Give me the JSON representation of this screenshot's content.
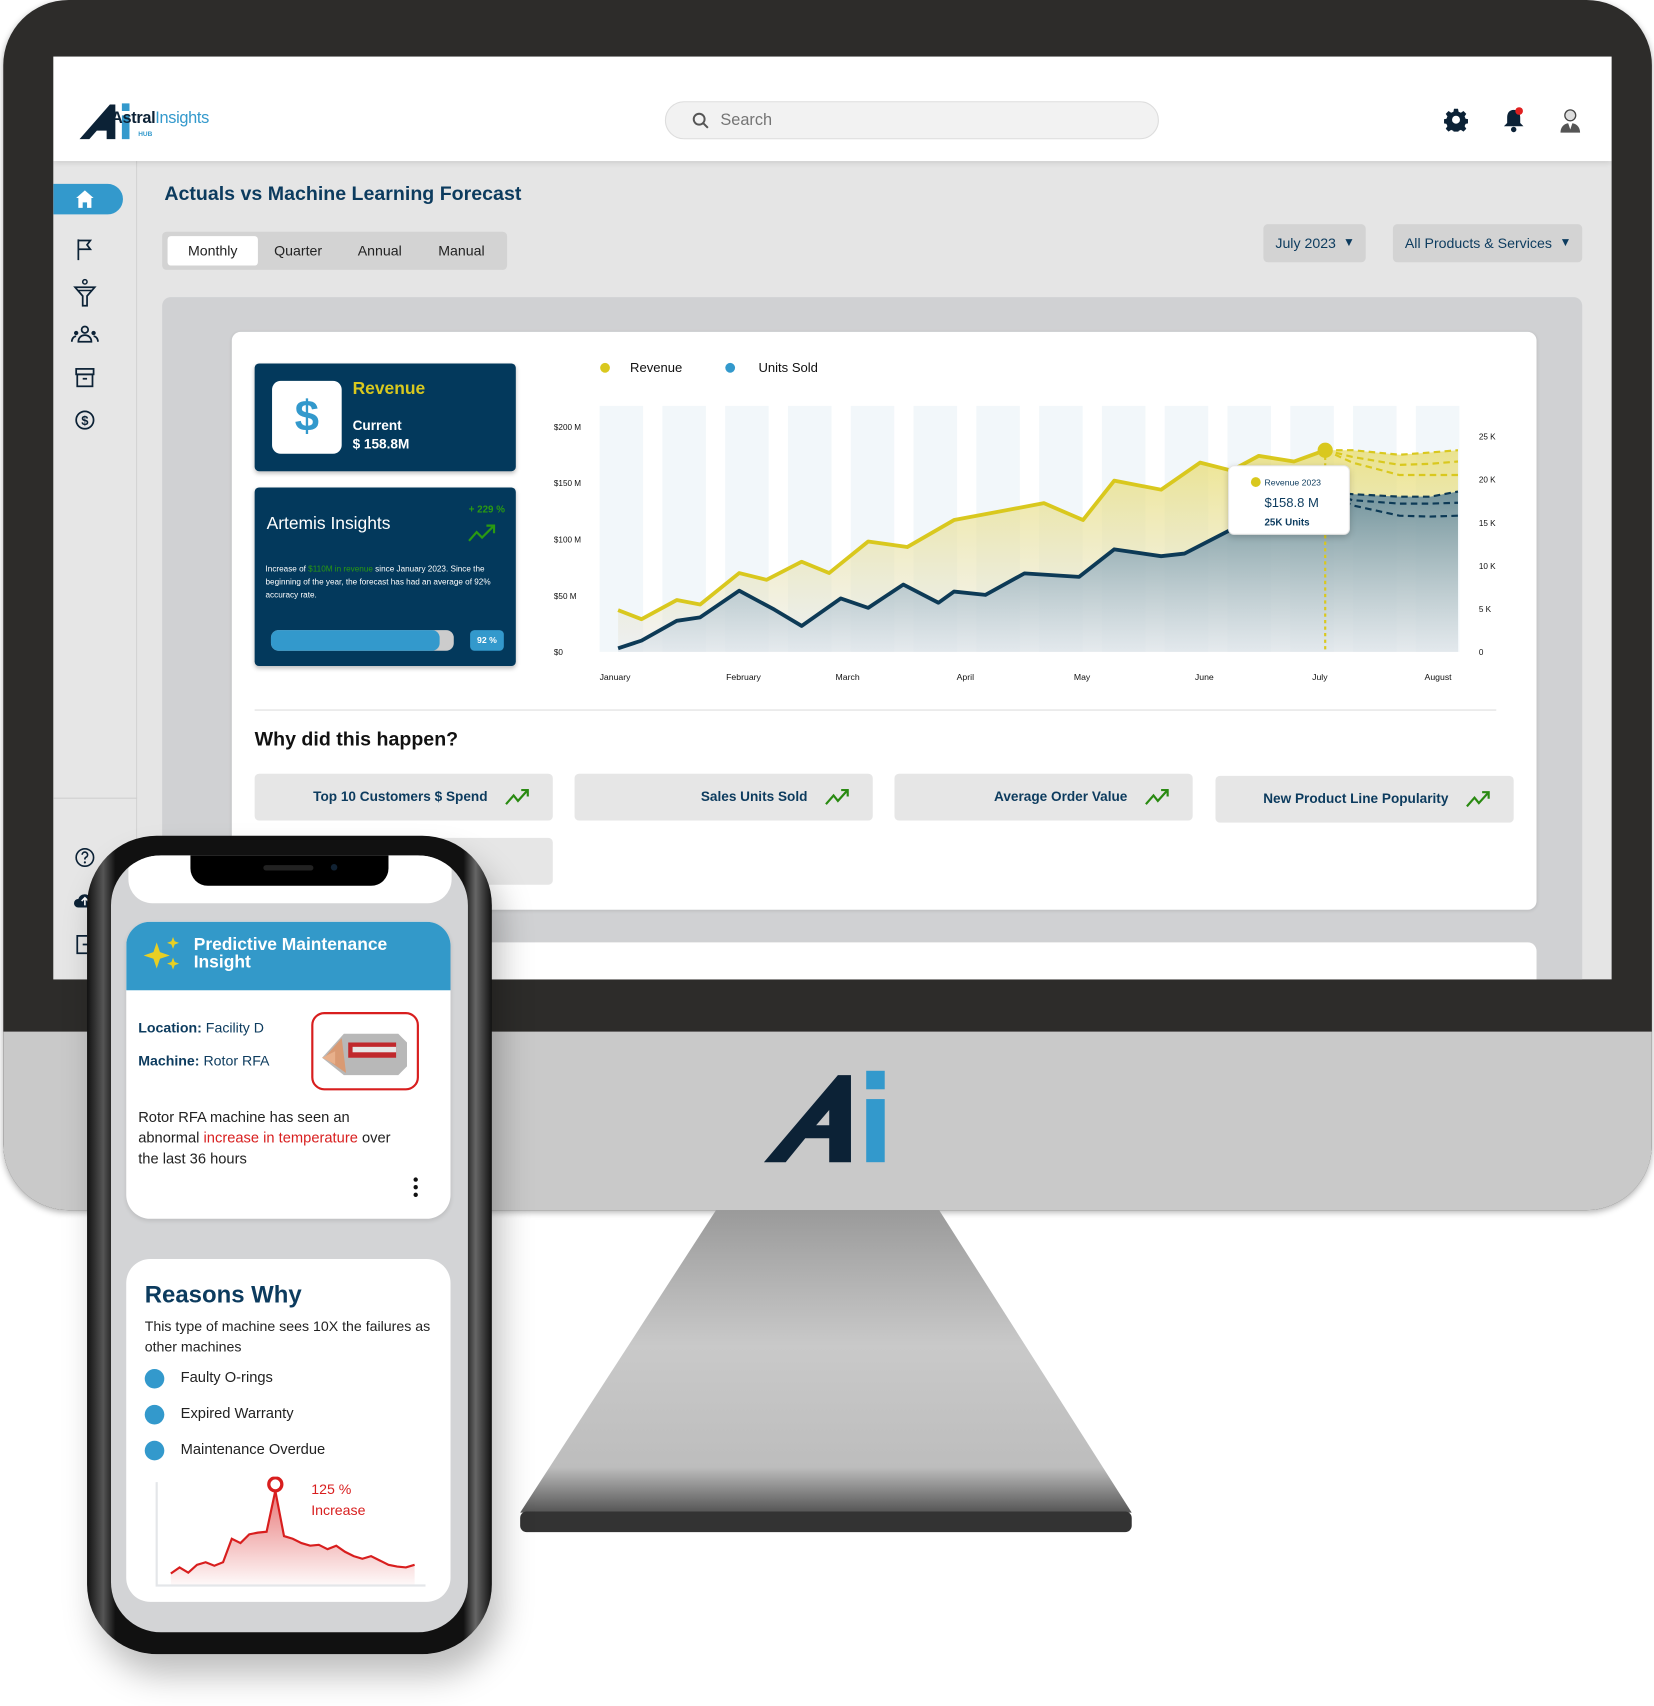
{
  "colors": {
    "navy": "#0c3b5e",
    "card_navy": "#03395c",
    "revenue": "#d9c81e",
    "units": "#0d3a56",
    "accent_blue": "#3399cc",
    "positive": "#2a8a12",
    "alert": "#d81e1e"
  },
  "header": {
    "logo": {
      "brand": "Astral",
      "brand2": "Insights",
      "sub": "HUB"
    },
    "search_placeholder": "Search",
    "icons": [
      "gear-icon",
      "bell-icon",
      "avatar"
    ]
  },
  "sidebar": {
    "items": [
      "home-icon",
      "flag-icon",
      "funnel-icon",
      "people-icon",
      "archive-icon",
      "dollar-icon"
    ],
    "bottom": [
      "help-icon",
      "cloud-upload-icon",
      "logout-icon"
    ],
    "active": "home"
  },
  "page": {
    "title": "Actuals vs Machine Learning Forecast",
    "tabs": [
      {
        "label": "Monthly",
        "active": true
      },
      {
        "label": "Quarter"
      },
      {
        "label": "Annual"
      },
      {
        "label": "Manual"
      }
    ],
    "period": "July 2023",
    "filter": "All Products & Services"
  },
  "revenue_card": {
    "title": "Revenue",
    "current_label": "Current",
    "current_value": "$ 158.8M",
    "icon": "dollar-icon"
  },
  "artemis": {
    "title": "Artemis Insights",
    "change": "+ 229 %",
    "text_pre": "Increase of ",
    "text_highlight": "$110M in revenue",
    "text_post": " since January 2023. Since the beginning of the year, the forecast has had an average of 92% accuracy rate.",
    "accuracy_percent": 92,
    "accuracy_label": "92 %"
  },
  "chart_data": {
    "type": "area",
    "legend": [
      "Revenue",
      "Units Sold"
    ],
    "legend_placement": "top-left",
    "x_tick_labels": [
      "January",
      "February",
      "March",
      "April",
      "May",
      "June",
      "July",
      "August"
    ],
    "x_tick_dates": [
      "2023-01-01",
      "2023-02-01",
      "2023-03-01",
      "2023-04-01",
      "2023-05-01",
      "2023-06-01",
      "2023-07-01",
      "2023-08-01"
    ],
    "y_left": {
      "ticks": [
        "$200 M",
        "$150 M",
        "$100 M",
        "$50 M",
        "$0"
      ],
      "range": [
        0,
        200
      ],
      "unit": "$M"
    },
    "y_right": {
      "ticks": [
        "25 K",
        "20 K",
        "15 K",
        "10 K",
        "5 K",
        "0"
      ],
      "range": [
        0,
        25
      ],
      "unit": "K units"
    },
    "series": [
      {
        "name": "Revenue",
        "axis": "left",
        "x": [
          "2023-01-01",
          "2023-01-07",
          "2023-01-16",
          "2023-01-22",
          "2023-02-01",
          "2023-02-08",
          "2023-02-17",
          "2023-02-24",
          "2023-03-06",
          "2023-03-16",
          "2023-03-28",
          "2023-04-20",
          "2023-04-30",
          "2023-05-08",
          "2023-05-20",
          "2023-05-30",
          "2023-06-07",
          "2023-06-14",
          "2023-06-23",
          "2023-07-01"
        ],
        "values": [
          37,
          29,
          46,
          42,
          70,
          64,
          80,
          70,
          98,
          93,
          117,
          132,
          117,
          152,
          144,
          168,
          161,
          174,
          169,
          179
        ]
      },
      {
        "name": "Units Sold",
        "axis": "right",
        "x": [
          "2023-01-01",
          "2023-01-07",
          "2023-01-16",
          "2023-01-22",
          "2023-02-01",
          "2023-02-10",
          "2023-02-17",
          "2023-02-27",
          "2023-03-06",
          "2023-03-15",
          "2023-03-24",
          "2023-03-28",
          "2023-04-05",
          "2023-04-15",
          "2023-04-29",
          "2023-05-08",
          "2023-05-20",
          "2023-05-26",
          "2023-06-07",
          "2023-07-01"
        ],
        "values": [
          0.4,
          1.3,
          3.6,
          4.0,
          7.1,
          4.9,
          3.0,
          6.2,
          5.1,
          7.8,
          5.7,
          7.0,
          6.6,
          9.1,
          8.7,
          11.9,
          11.1,
          11.4,
          14.2,
          18.6
        ]
      }
    ],
    "forecast": {
      "x": [
        "2023-07-01",
        "2023-07-08",
        "2023-07-20",
        "2023-07-28",
        "2023-08-04"
      ],
      "revenue": [
        [
          179,
          179,
          175,
          177,
          179
        ],
        [
          179,
          173,
          166,
          167,
          169
        ],
        [
          179,
          168,
          157,
          157,
          157
        ]
      ],
      "units": [
        [
          18.6,
          18.3,
          18.0,
          18.0,
          18.6
        ],
        [
          18.6,
          17.6,
          17.2,
          17.2,
          17.3
        ],
        [
          18.6,
          17.0,
          15.8,
          15.7,
          15.8
        ]
      ]
    },
    "marker": {
      "date": "2023-07-01",
      "label": "Revenue 2023",
      "value": "$158.8 M",
      "units": "25K Units"
    }
  },
  "why": {
    "title": "Why did this happen?",
    "cards": [
      "Top 10 Customers $ Spend",
      "Sales Units Sold",
      "Average Order Value",
      "New Product Line Popularity"
    ]
  },
  "phone": {
    "insight": {
      "title": "Predictive Maintenance Insight",
      "location_label": "Location:",
      "location": "Facility D",
      "machine_label": "Machine:",
      "machine": "Rotor RFA",
      "text_pre": "Rotor RFA machine has seen an abnormal ",
      "text_highlight": "increase in temperature",
      "text_post": " over the last 36 hours"
    },
    "reasons": {
      "title": "Reasons Why",
      "text": "This type of machine sees 10X the failures as other machines",
      "items": [
        "Faulty O-rings",
        "Expired Warranty",
        "Maintenance Overdue"
      ],
      "spark": [
        5,
        12,
        6,
        15,
        18,
        14,
        18,
        45,
        40,
        50,
        52,
        53,
        100,
        48,
        45,
        40,
        37,
        38,
        33,
        37,
        30,
        25,
        22,
        25,
        20,
        15,
        13,
        12,
        15
      ],
      "peak_value": "125 %",
      "peak_label": "Increase"
    }
  }
}
